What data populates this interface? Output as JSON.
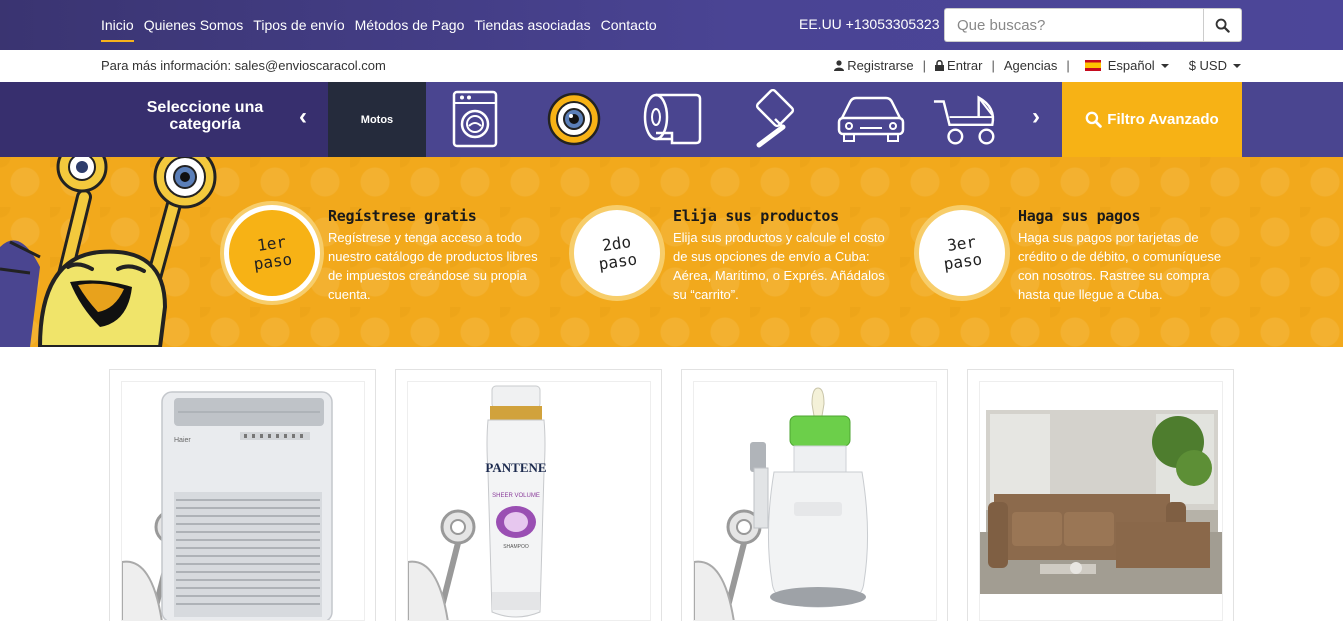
{
  "nav": {
    "items": [
      {
        "label": "Inicio",
        "active": true
      },
      {
        "label": "Quienes Somos"
      },
      {
        "label": "Tipos de envío"
      },
      {
        "label": "Métodos de Pago"
      },
      {
        "label": "Tiendas asociadas"
      },
      {
        "label": "Contacto"
      }
    ],
    "phone": "EE.UU +13053305323",
    "search_placeholder": "Que buscas?"
  },
  "infobar": {
    "info": "Para más información: sales@envioscaracol.com",
    "register": "Registrarse",
    "login": "Entrar",
    "agencies": "Agencias",
    "language": "Español",
    "currency": "$ USD"
  },
  "categories": {
    "select_label": "Seleccione una categoría",
    "active": "Motos",
    "icons": [
      "washing-machine-icon",
      "snail-eye-icon",
      "toilet-paper-icon",
      "paint-roller-icon",
      "car-icon",
      "baby-stroller-icon"
    ],
    "filter_label": "Filtro Avanzado"
  },
  "steps": [
    {
      "badge_1": "1er",
      "badge_2": "paso",
      "title": "Regístrese gratis",
      "text": "Regístrese y tenga acceso a todo nuestro catálogo de productos libres de impuestos creándose su propia cuenta."
    },
    {
      "badge_1": "2do",
      "badge_2": "paso",
      "title": "Elija sus productos",
      "text": "Elija sus productos y calcule el costo de sus opciones de envío a Cuba: Aérea, Marítimo, o Exprés. Añádalos su “carrito”."
    },
    {
      "badge_1": "3er",
      "badge_2": "paso",
      "title": "Haga sus pagos",
      "text": "Haga sus pagos por tarjetas de crédito o de débito, o comuníquese con nosotros. Rastree su compra hasta que llegue a Cuba."
    }
  ],
  "products": [
    {
      "name": "air-conditioner",
      "brand_text": "Haier"
    },
    {
      "name": "shampoo",
      "brand_text": "PANTENE",
      "sub_text": "SHEER VOLUME",
      "type_text": "SHAMPOO"
    },
    {
      "name": "bottle-warmer"
    },
    {
      "name": "sofa"
    }
  ],
  "colors": {
    "nav_bg": "#403a80",
    "accent": "#f7b215",
    "banner": "#f2a91c",
    "active_cat": "#252b3c"
  }
}
